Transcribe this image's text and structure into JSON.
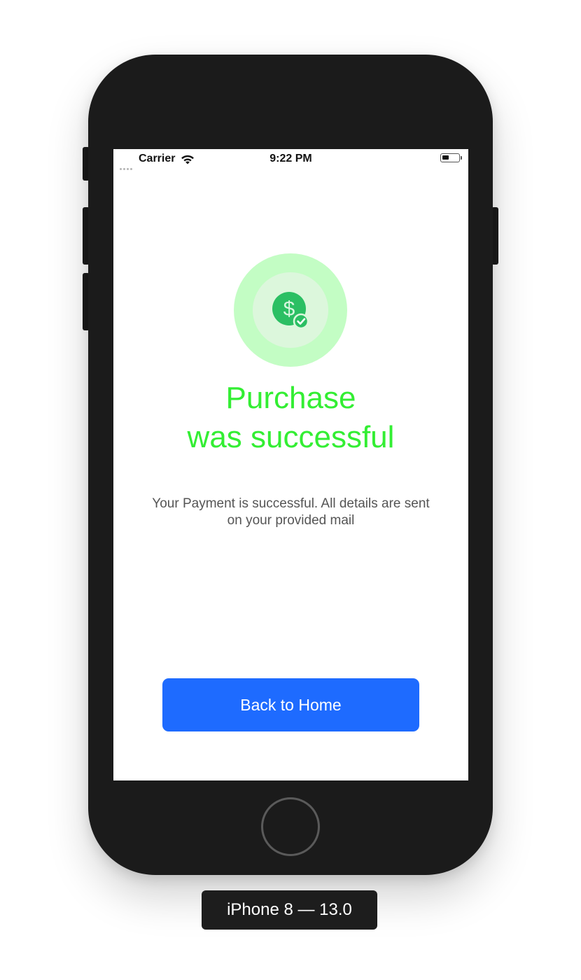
{
  "status_bar": {
    "carrier": "Carrier",
    "time": "9:22 PM"
  },
  "screen": {
    "icon": "dollar-check-icon",
    "title_line1": "Purchase",
    "title_line2": "was successful",
    "message_line1": "Your Payment is successful. All details are sent",
    "message_line2": "on your provided mail",
    "button_label": "Back to Home"
  },
  "device_label": "iPhone 8 — 13.0",
  "colors": {
    "title_green": "#33ee33",
    "badge_outer": "#c3fdc4",
    "badge_inner": "#dcf7dc",
    "icon_green": "#2bbf63",
    "button_blue": "#1e6bff",
    "phone_body": "#1b1b1b"
  }
}
